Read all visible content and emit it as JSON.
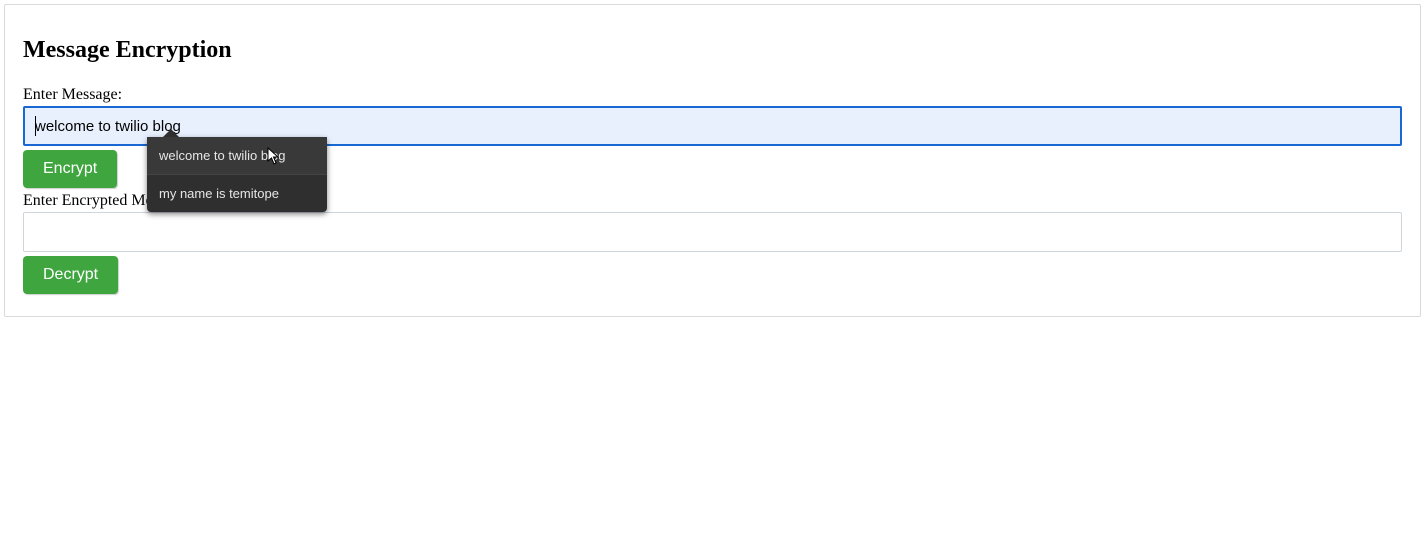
{
  "title": "Message Encryption",
  "labels": {
    "enter_message": "Enter Message:",
    "enter_encrypted": "Enter Encrypted Message:"
  },
  "inputs": {
    "message_value": "welcome to twilio blog",
    "encrypted_value": ""
  },
  "buttons": {
    "encrypt": "Encrypt",
    "decrypt": "Decrypt"
  },
  "autocomplete": {
    "items": [
      "welcome to twilio blog",
      "my name is temitope"
    ]
  }
}
